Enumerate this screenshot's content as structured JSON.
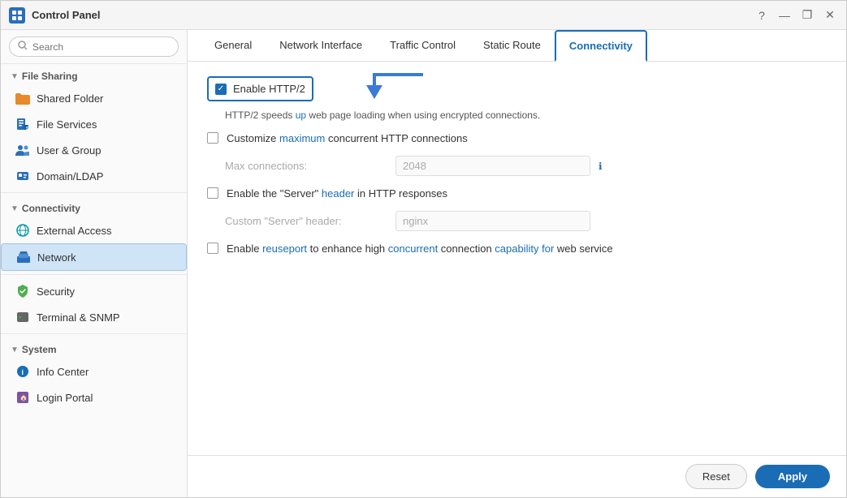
{
  "window": {
    "title": "Control Panel",
    "controls": [
      "?",
      "—",
      "❐",
      "✕"
    ]
  },
  "sidebar": {
    "search_placeholder": "Search",
    "sections": [
      {
        "id": "file-sharing",
        "label": "File Sharing",
        "expanded": true,
        "items": [
          {
            "id": "shared-folder",
            "label": "Shared Folder",
            "icon": "folder-orange"
          },
          {
            "id": "file-services",
            "label": "File Services",
            "icon": "file-blue"
          },
          {
            "id": "user-group",
            "label": "User & Group",
            "icon": "user-blue"
          },
          {
            "id": "domain-ldap",
            "label": "Domain/LDAP",
            "icon": "domain-blue"
          }
        ]
      },
      {
        "id": "connectivity",
        "label": "Connectivity",
        "expanded": true,
        "items": [
          {
            "id": "external-access",
            "label": "External Access",
            "icon": "globe-teal"
          },
          {
            "id": "network",
            "label": "Network",
            "icon": "network-blue",
            "active": true
          }
        ]
      },
      {
        "id": "security-section",
        "label": "",
        "items": [
          {
            "id": "security",
            "label": "Security",
            "icon": "shield-green"
          },
          {
            "id": "terminal-snmp",
            "label": "Terminal & SNMP",
            "icon": "terminal-gray"
          }
        ]
      },
      {
        "id": "system",
        "label": "System",
        "expanded": true,
        "items": [
          {
            "id": "info-center",
            "label": "Info Center",
            "icon": "info-blue"
          },
          {
            "id": "login-portal",
            "label": "Login Portal",
            "icon": "login-purple"
          }
        ]
      }
    ]
  },
  "tabs": [
    {
      "id": "general",
      "label": "General"
    },
    {
      "id": "network-interface",
      "label": "Network Interface"
    },
    {
      "id": "traffic-control",
      "label": "Traffic Control"
    },
    {
      "id": "static-route",
      "label": "Static Route"
    },
    {
      "id": "connectivity",
      "label": "Connectivity",
      "active": true
    }
  ],
  "panel": {
    "http2": {
      "label": "Enable HTTP/2",
      "checked": true,
      "description": "HTTP/2 speeds up web page loading when using encrypted connections."
    },
    "max_connections": {
      "label": "Customize maximum concurrent HTTP connections",
      "checked": false,
      "field_label": "Max connections:",
      "field_value": "2048"
    },
    "server_header": {
      "label": "Enable the \"Server\" header in HTTP responses",
      "checked": false,
      "field_label": "Custom \"Server\" header:",
      "field_value": "nginx"
    },
    "reuseport": {
      "label": "Enable reuseport to enhance high concurrent connection capability for web service",
      "checked": false
    }
  },
  "footer": {
    "reset_label": "Reset",
    "apply_label": "Apply"
  }
}
